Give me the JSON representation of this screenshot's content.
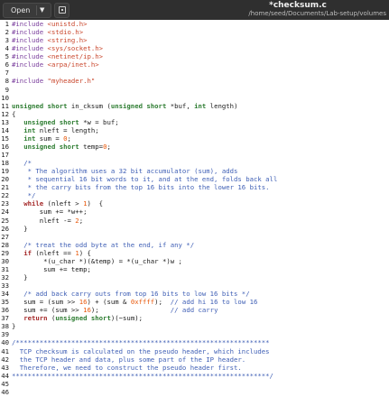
{
  "window": {
    "open_label": "Open",
    "title": "*checksum.c",
    "path": "/home/seed/Documents/Lab-setup/volumes"
  },
  "icons": [
    "chevron-down-icon",
    "pin-icon"
  ],
  "colors": {
    "preprocessor": "#7a3e9d",
    "string": "#c9462c",
    "type": "#2e7d32",
    "keyword": "#a52a2a",
    "number": "#e8590c",
    "comment": "#3f5fb5"
  },
  "code_lines": [
    [
      [
        "pp",
        "#include "
      ],
      [
        "str",
        "<unistd.h>"
      ]
    ],
    [
      [
        "pp",
        "#include "
      ],
      [
        "str",
        "<stdio.h>"
      ]
    ],
    [
      [
        "pp",
        "#include "
      ],
      [
        "str",
        "<string.h>"
      ]
    ],
    [
      [
        "pp",
        "#include "
      ],
      [
        "str",
        "<sys/socket.h>"
      ]
    ],
    [
      [
        "pp",
        "#include "
      ],
      [
        "str",
        "<netinet/ip.h>"
      ]
    ],
    [
      [
        "pp",
        "#include "
      ],
      [
        "str",
        "<arpa/inet.h>"
      ]
    ],
    [],
    [
      [
        "pp",
        "#include "
      ],
      [
        "str",
        "\"myheader.h\""
      ]
    ],
    [],
    [],
    [
      [
        "type",
        "unsigned short"
      ],
      [
        "txt",
        " in_cksum ("
      ],
      [
        "type",
        "unsigned short"
      ],
      [
        "txt",
        " *buf, "
      ],
      [
        "type",
        "int"
      ],
      [
        "txt",
        " length)"
      ]
    ],
    [
      [
        "txt",
        "{"
      ]
    ],
    [
      [
        "txt",
        "   "
      ],
      [
        "type",
        "unsigned short"
      ],
      [
        "txt",
        " *w = buf;"
      ]
    ],
    [
      [
        "txt",
        "   "
      ],
      [
        "type",
        "int"
      ],
      [
        "txt",
        " nleft = length;"
      ]
    ],
    [
      [
        "txt",
        "   "
      ],
      [
        "type",
        "int"
      ],
      [
        "txt",
        " sum = "
      ],
      [
        "num",
        "0"
      ],
      [
        "txt",
        ";"
      ]
    ],
    [
      [
        "txt",
        "   "
      ],
      [
        "type",
        "unsigned short"
      ],
      [
        "txt",
        " temp="
      ],
      [
        "num",
        "0"
      ],
      [
        "txt",
        ";"
      ]
    ],
    [],
    [
      [
        "txt",
        "   "
      ],
      [
        "com",
        "/*"
      ]
    ],
    [
      [
        "com",
        "    * The algorithm uses a 32 bit accumulator (sum), adds"
      ]
    ],
    [
      [
        "com",
        "    * sequential 16 bit words to it, and at the end, folds back all"
      ]
    ],
    [
      [
        "com",
        "    * the carry bits from the top 16 bits into the lower 16 bits."
      ]
    ],
    [
      [
        "com",
        "    */"
      ]
    ],
    [
      [
        "txt",
        "   "
      ],
      [
        "kw",
        "while"
      ],
      [
        "txt",
        " (nleft > "
      ],
      [
        "num",
        "1"
      ],
      [
        "txt",
        ")  {"
      ]
    ],
    [
      [
        "txt",
        "       sum += *w++;"
      ]
    ],
    [
      [
        "txt",
        "       nleft -= "
      ],
      [
        "num",
        "2"
      ],
      [
        "txt",
        ";"
      ]
    ],
    [
      [
        "txt",
        "   }"
      ]
    ],
    [],
    [
      [
        "txt",
        "   "
      ],
      [
        "com",
        "/* treat the odd byte at the end, if any */"
      ]
    ],
    [
      [
        "txt",
        "   "
      ],
      [
        "kw",
        "if"
      ],
      [
        "txt",
        " (nleft == "
      ],
      [
        "num",
        "1"
      ],
      [
        "txt",
        ") {"
      ]
    ],
    [
      [
        "txt",
        "        *(u_char *)(&temp) = *(u_char *)w ;"
      ]
    ],
    [
      [
        "txt",
        "        sum += temp;"
      ]
    ],
    [
      [
        "txt",
        "   }"
      ]
    ],
    [],
    [
      [
        "txt",
        "   "
      ],
      [
        "com",
        "/* add back carry outs from top 16 bits to low 16 bits */"
      ]
    ],
    [
      [
        "txt",
        "   sum = (sum >> "
      ],
      [
        "num",
        "16"
      ],
      [
        "txt",
        ") + (sum & "
      ],
      [
        "num",
        "0xffff"
      ],
      [
        "txt",
        ");  "
      ],
      [
        "com",
        "// add hi 16 to low 16"
      ]
    ],
    [
      [
        "txt",
        "   sum += (sum >> "
      ],
      [
        "num",
        "16"
      ],
      [
        "txt",
        ");                  "
      ],
      [
        "com",
        "// add carry"
      ]
    ],
    [
      [
        "txt",
        "   "
      ],
      [
        "kw",
        "return"
      ],
      [
        "txt",
        " ("
      ],
      [
        "type",
        "unsigned short"
      ],
      [
        "txt",
        ")(~sum);"
      ]
    ],
    [
      [
        "txt",
        "}"
      ]
    ],
    [],
    [
      [
        "com",
        "/****************************************************************"
      ]
    ],
    [
      [
        "com",
        "  TCP checksum is calculated on the pseudo header, which includes"
      ]
    ],
    [
      [
        "com",
        "  the TCP header and data, plus some part of the IP header."
      ]
    ],
    [
      [
        "com",
        "  Therefore, we need to construct the pseudo header first."
      ]
    ],
    [
      [
        "com",
        "*****************************************************************/"
      ]
    ],
    [],
    []
  ]
}
